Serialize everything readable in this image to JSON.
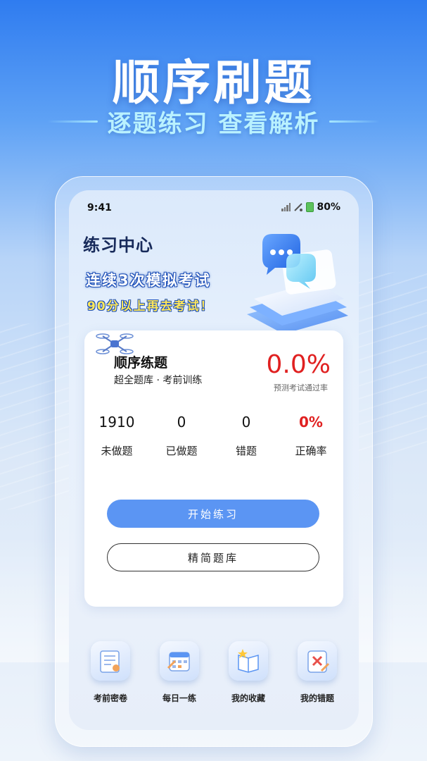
{
  "promo": {
    "title": "顺序刷题",
    "subtitle": "逐题练习 查看解析"
  },
  "status_bar": {
    "time": "9:41",
    "battery": "80%"
  },
  "screen": {
    "title": "练习中心",
    "banner_line1": "连续3次模拟考试",
    "banner_line2": "90分以上再去考试！"
  },
  "card": {
    "title": "顺序练题",
    "subtitle": "超全题库 · 考前训练",
    "pass_rate": "0.0%",
    "pass_rate_label": "预测考试通过率",
    "stats": [
      {
        "value": "1910",
        "label": "未做题"
      },
      {
        "value": "0",
        "label": "已做题"
      },
      {
        "value": "0",
        "label": "错题"
      },
      {
        "value": "0%",
        "label": "正确率"
      }
    ],
    "start_button": "开始练习",
    "lite_button": "精简题库"
  },
  "shortcuts": [
    {
      "label": "考前密卷",
      "icon": "exam-paper-icon"
    },
    {
      "label": "每日一练",
      "icon": "calendar-icon"
    },
    {
      "label": "我的收藏",
      "icon": "book-star-icon"
    },
    {
      "label": "我的错题",
      "icon": "wrong-answer-icon"
    }
  ],
  "colors": {
    "accent": "#5b95f3",
    "error_red": "#e02020",
    "title_dark": "#172a5a"
  }
}
